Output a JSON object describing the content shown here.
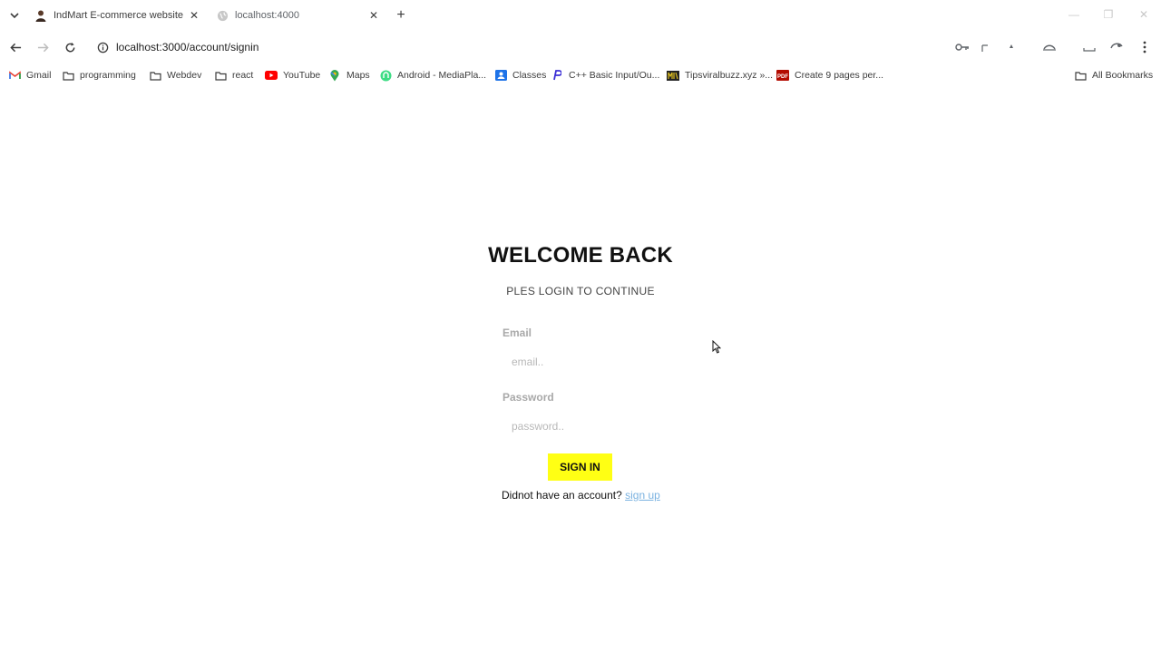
{
  "tabs": [
    {
      "title": "IndMart E-commerce website",
      "active": true
    },
    {
      "title": "localhost:4000",
      "active": false
    }
  ],
  "address": {
    "url": "localhost:3000/account/signin"
  },
  "bookmarks": [
    {
      "label": "Gmail",
      "icon": "gmail-icon"
    },
    {
      "label": "programming",
      "icon": "folder-icon"
    },
    {
      "label": "Webdev",
      "icon": "folder-icon"
    },
    {
      "label": "react",
      "icon": "folder-icon"
    },
    {
      "label": "YouTube",
      "icon": "youtube-icon"
    },
    {
      "label": "Maps",
      "icon": "maps-icon"
    },
    {
      "label": "Android - MediaPla...",
      "icon": "android-icon"
    },
    {
      "label": "Classes",
      "icon": "classes-icon"
    },
    {
      "label": "C++ Basic Input/Ou...",
      "icon": "cpp-icon"
    },
    {
      "label": "Tipsviralbuzz.xyz »...",
      "icon": "site-icon"
    },
    {
      "label": "Create 9 pages per...",
      "icon": "pdf-icon"
    }
  ],
  "all_bookmarks_label": "All Bookmarks",
  "pdf_badge": "PDF",
  "signin": {
    "title": "WELCOME BACK",
    "subtitle": "PLES LOGIN TO CONTINUE",
    "email_label": "Email",
    "email_placeholder": "email..",
    "password_label": "Password",
    "password_placeholder": "password..",
    "button_label": "SIGN IN",
    "no_account_text": "Didnot have an account?",
    "signup_link": "sign up"
  },
  "colors": {
    "button_bg": "#ffff14",
    "link": "#7ab2e0",
    "label": "#a9a9a9"
  }
}
